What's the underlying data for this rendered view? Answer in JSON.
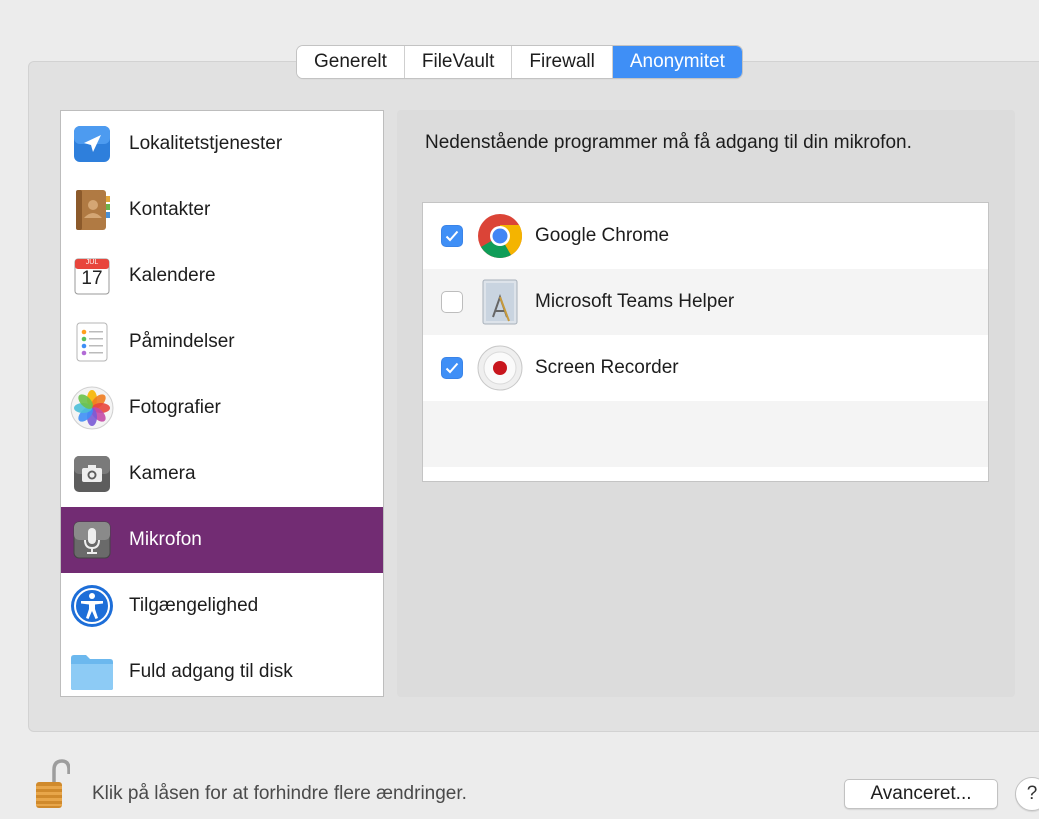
{
  "tabs": [
    {
      "label": "Generelt",
      "active": false
    },
    {
      "label": "FileVault",
      "active": false
    },
    {
      "label": "Firewall",
      "active": false
    },
    {
      "label": "Anonymitet",
      "active": true
    }
  ],
  "sidebar": {
    "items": [
      {
        "label": "Lokalitetstjenester",
        "icon": "location-arrow-icon"
      },
      {
        "label": "Kontakter",
        "icon": "contacts-book-icon"
      },
      {
        "label": "Kalendere",
        "icon": "calendar-icon",
        "calendar_month": "JUL",
        "calendar_day": "17"
      },
      {
        "label": "Påmindelser",
        "icon": "reminders-icon"
      },
      {
        "label": "Fotografier",
        "icon": "photos-icon"
      },
      {
        "label": "Kamera",
        "icon": "camera-icon"
      },
      {
        "label": "Mikrofon",
        "icon": "microphone-icon",
        "selected": true
      },
      {
        "label": "Tilgængelighed",
        "icon": "accessibility-icon"
      },
      {
        "label": "Fuld adgang til disk",
        "icon": "folder-icon"
      }
    ]
  },
  "panel": {
    "title": "Nedenstående programmer må få adgang til din mikrofon.",
    "apps": [
      {
        "name": "Google Chrome",
        "checked": true,
        "icon": "chrome-icon"
      },
      {
        "name": "Microsoft Teams Helper",
        "checked": false,
        "icon": "generic-app-icon"
      },
      {
        "name": "Screen Recorder",
        "checked": true,
        "icon": "record-icon"
      }
    ]
  },
  "footer": {
    "lock_text": "Klik på låsen for at forhindre flere ændringer.",
    "advanced_label": "Avanceret...",
    "help_label": "?"
  },
  "colors": {
    "selected_row": "#722c73",
    "accent": "#3f8ff6"
  }
}
